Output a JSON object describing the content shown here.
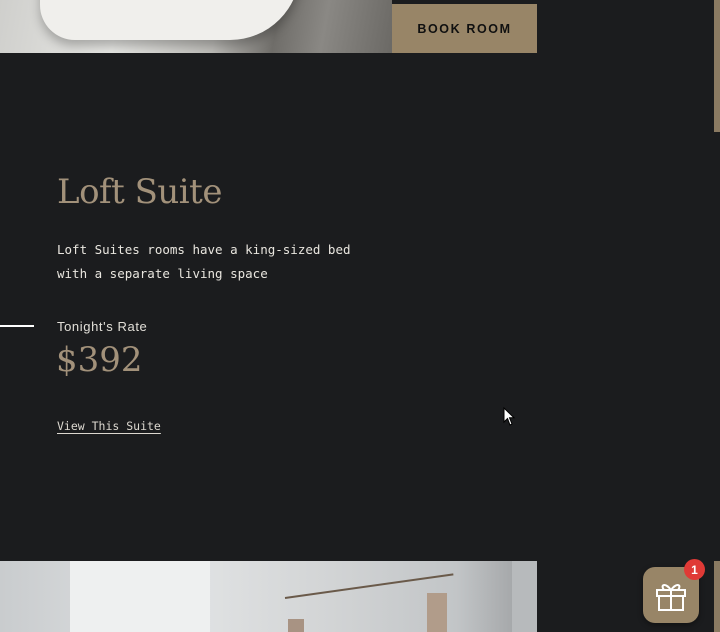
{
  "header": {
    "book_button_label": "BOOK ROOM"
  },
  "suite": {
    "title": "Loft Suite",
    "description": "Loft Suites rooms have a king-sized bed with a separate living space",
    "rate_label": "Tonight's Rate",
    "price": "$392",
    "link_label": "View This Suite"
  },
  "gift": {
    "badge_count": "1",
    "icon": "gift-icon"
  },
  "colors": {
    "accent": "#988567",
    "background": "#1b1c1e",
    "badge": "#e03a36"
  }
}
